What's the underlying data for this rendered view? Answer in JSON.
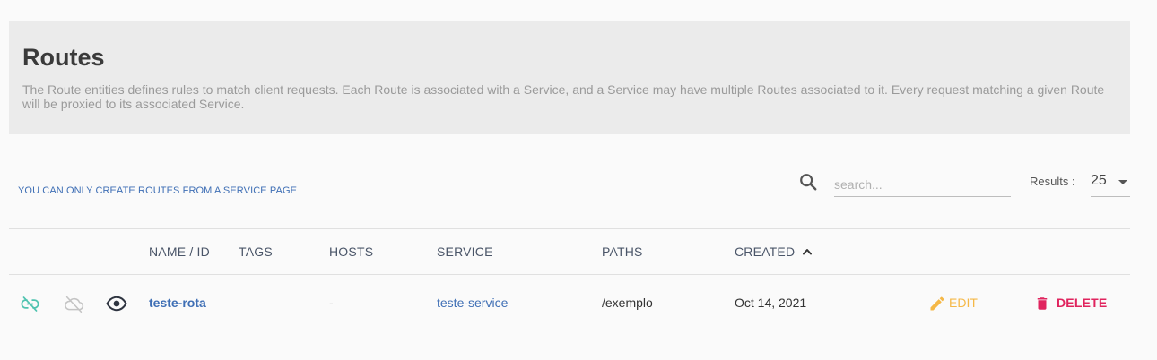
{
  "header": {
    "title": "Routes",
    "description": "The Route entities defines rules to match client requests. Each Route is associated with a Service, and a Service may have multiple Routes associated to it. Every request matching a given Route will be proxied to its associated Service."
  },
  "toolbar": {
    "notice": "YOU CAN ONLY CREATE ROUTES FROM A SERVICE PAGE",
    "search_placeholder": "search...",
    "results_label": "Results :",
    "results_value": "25"
  },
  "table": {
    "columns": [
      "NAME / ID",
      "TAGS",
      "HOSTS",
      "SERVICE",
      "PATHS",
      "CREATED"
    ],
    "sorted_column": "CREATED",
    "sort_direction": "ascending",
    "rows": [
      {
        "name": "teste-rota",
        "tags": "",
        "hosts": "-",
        "service": "teste-service",
        "paths": "/exemplo",
        "created": "Oct 14, 2021",
        "edit_label": "EDIT",
        "delete_label": "DELETE"
      }
    ]
  },
  "colors": {
    "accent_link": "#3f6fb5",
    "edit": "#f5b847",
    "delete": "#e0245e",
    "status_teal": "#4fc3b0"
  },
  "icons": [
    "search-icon",
    "unlink-icon",
    "cloud-off-icon",
    "eye-icon",
    "chevron-up-icon",
    "pencil-icon",
    "trash-icon"
  ]
}
